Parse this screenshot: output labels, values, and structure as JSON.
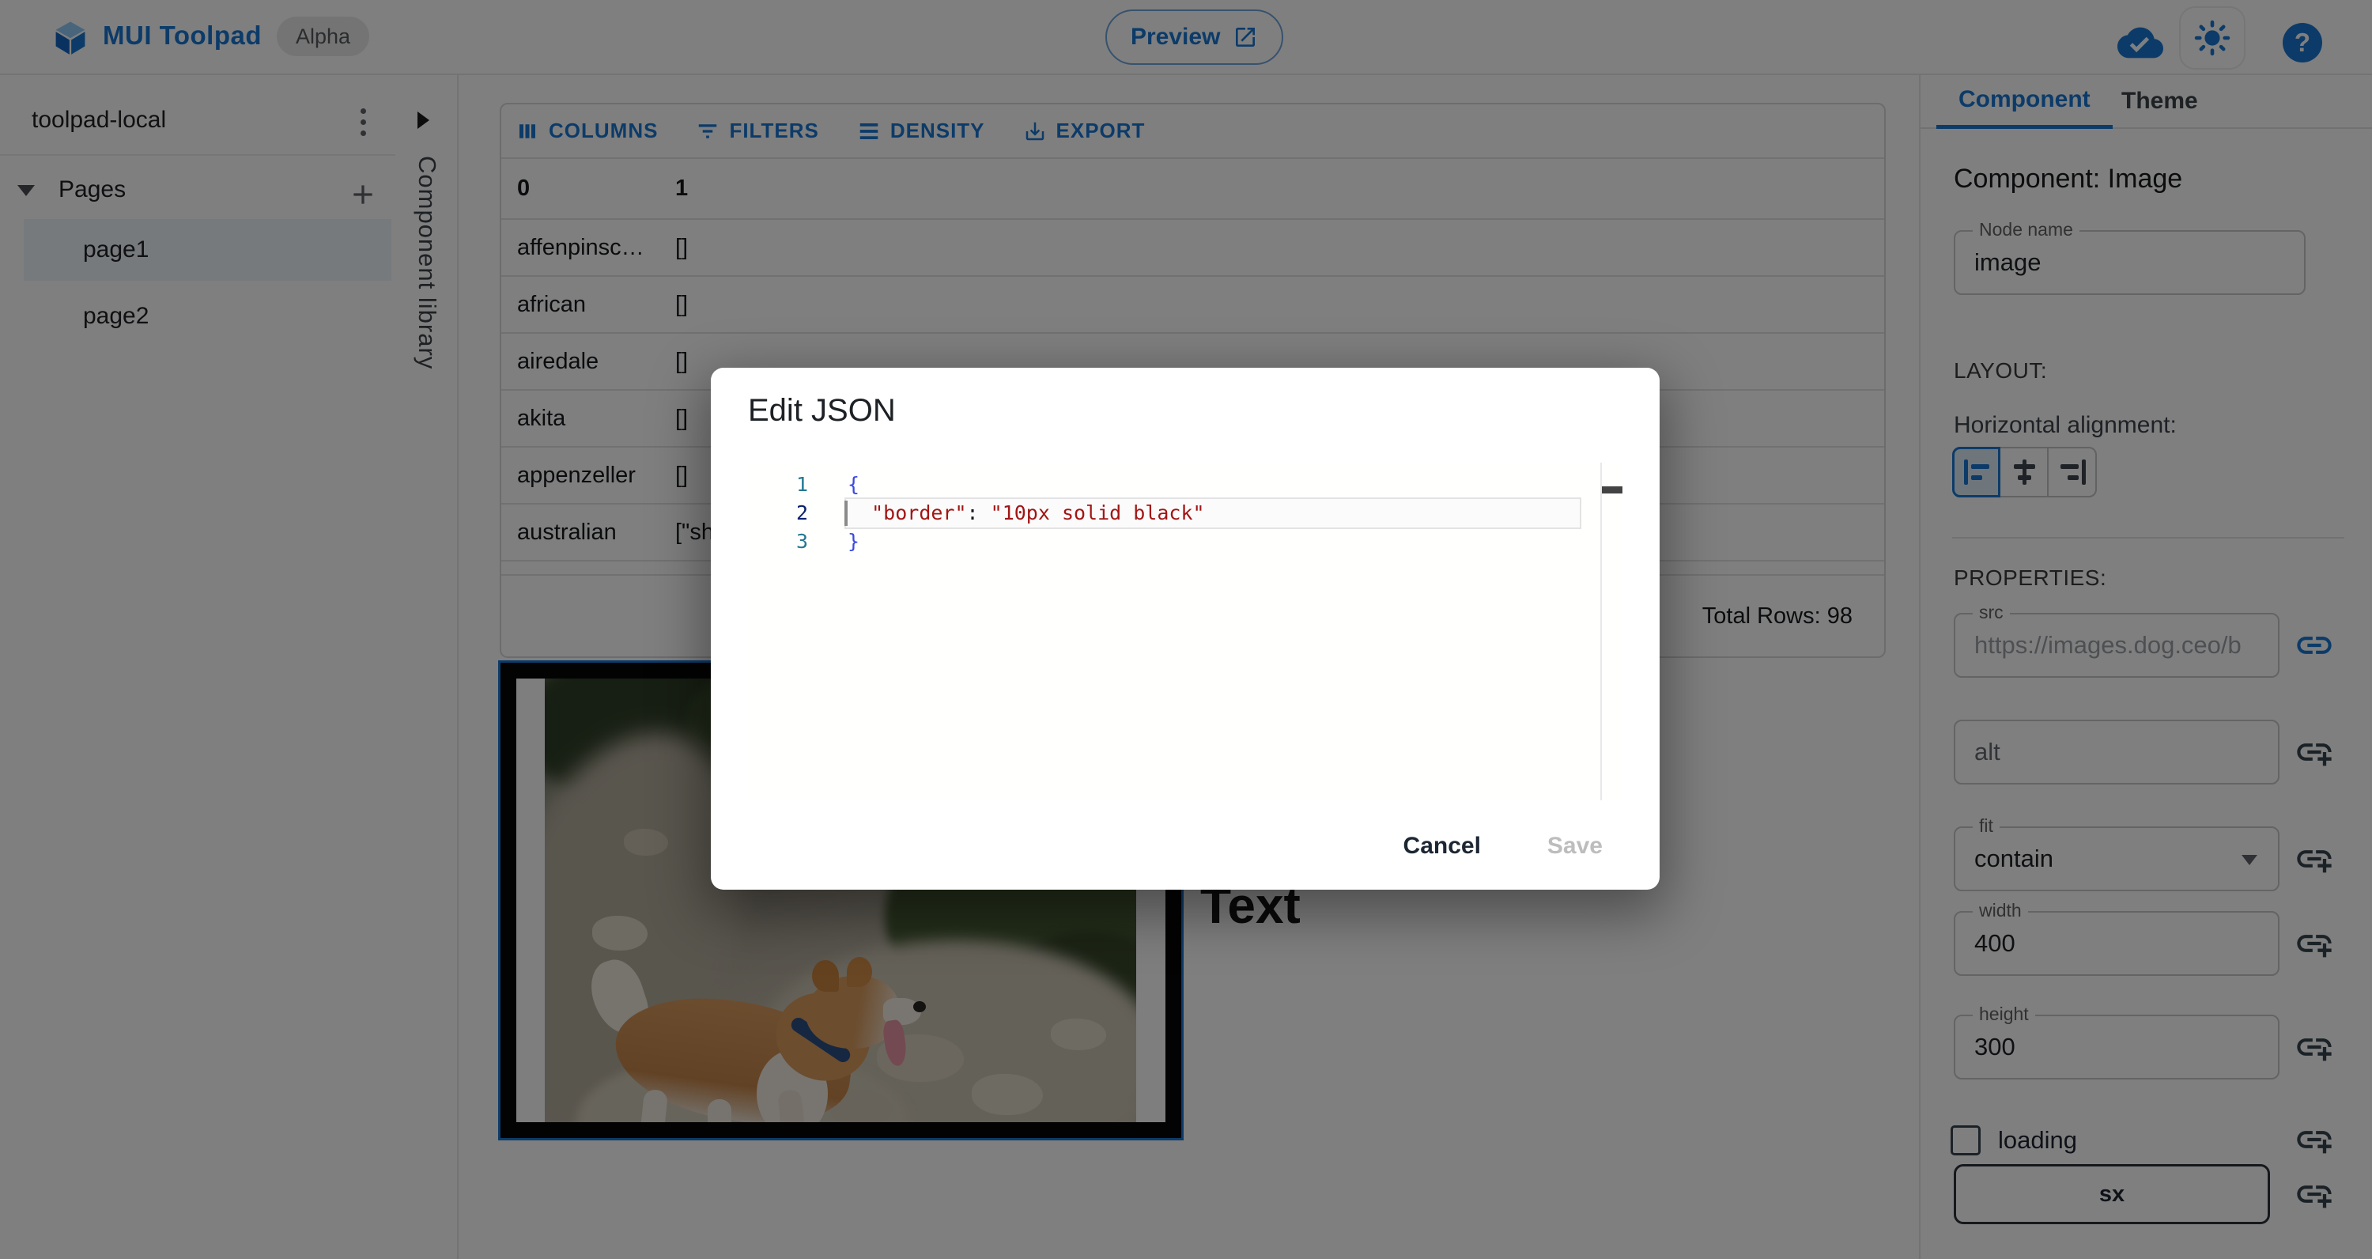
{
  "appBar": {
    "title": "MUI Toolpad",
    "badge": "Alpha",
    "preview_label": "Preview"
  },
  "explorer": {
    "project_name": "toolpad-local",
    "pages_label": "Pages",
    "pages": [
      {
        "name": "page1"
      },
      {
        "name": "page2"
      }
    ],
    "selected_page": "page1"
  },
  "componentLibrary": {
    "label": "Component library"
  },
  "dataGrid": {
    "toolbar": {
      "columns": "COLUMNS",
      "filters": "FILTERS",
      "density": "DENSITY",
      "export": "EXPORT"
    },
    "headers": [
      "0",
      "1"
    ],
    "rows": [
      {
        "c0": "affenpinsc…",
        "c1": "[]"
      },
      {
        "c0": "african",
        "c1": "[]"
      },
      {
        "c0": "airedale",
        "c1": "[]"
      },
      {
        "c0": "akita",
        "c1": "[]"
      },
      {
        "c0": "appenzeller",
        "c1": "[]"
      },
      {
        "c0": "australian",
        "c1": "[\"sh"
      }
    ],
    "footer": "Total Rows: 98"
  },
  "canvas": {
    "text_component": "Text"
  },
  "dialog": {
    "title": "Edit JSON",
    "code": {
      "line1_num": "1",
      "line1": "{",
      "line2_num": "2",
      "line2_indent": "  ",
      "line2_key": "\"border\"",
      "line2_colon": ": ",
      "line2_value": "\"10px solid black\"",
      "line3_num": "3",
      "line3": "}"
    },
    "cancel_label": "Cancel",
    "save_label": "Save"
  },
  "inspector": {
    "tabs": {
      "component": "Component",
      "theme": "Theme"
    },
    "active_tab": "Component",
    "heading": "Component: Image",
    "node_name": {
      "label": "Node name",
      "value": "image"
    },
    "layout_label": "LAYOUT:",
    "alignment_label": "Horizontal alignment:",
    "properties_label": "PROPERTIES:",
    "src": {
      "label": "src",
      "placeholder": "https://images.dog.ceo/b"
    },
    "alt": {
      "label": "alt"
    },
    "fit": {
      "label": "fit",
      "value": "contain"
    },
    "width": {
      "label": "width",
      "value": "400"
    },
    "height": {
      "label": "height",
      "value": "300"
    },
    "loading_label": "loading",
    "sx_label": "sx"
  },
  "colors": {
    "primary": "#1976d2",
    "string_token": "#a31515",
    "brace_token": "#3b49e0",
    "line_number": "#237893"
  }
}
